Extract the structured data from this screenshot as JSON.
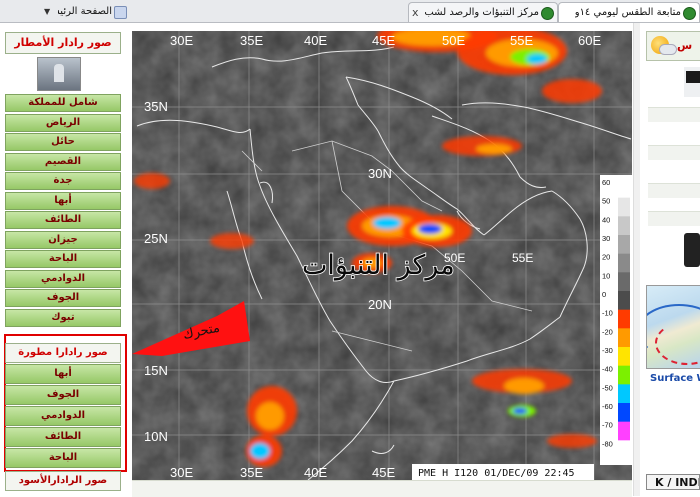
{
  "browser": {
    "tabs": [
      {
        "label": "متابعة الطقس ليومي ١٤و١٥ ١٢/...",
        "active": true
      },
      {
        "label": "مركز التنبؤات والرصد لشب...",
        "active": false
      },
      {
        "label": "الصفحة الرئيسية",
        "active": false
      }
    ],
    "close_glyph": "x",
    "dropdown_glyph": "▼"
  },
  "left_panel": {
    "radar_title": "صور رادار الأمطار",
    "kingdom_items": [
      "شامل للمملكة",
      "الرياض",
      "حائل",
      "القصيم",
      "جدة",
      "أبها",
      "الطائف",
      "جيزان",
      "الباحة",
      "الدوادمي",
      "الجوف",
      "تبوك"
    ],
    "mobile_title": "صور رادارا مطورة",
    "mobile_items": [
      "أبها",
      "الجوف",
      "الدوادمي",
      "الطائف",
      "الباحة"
    ],
    "black_radar_title": "صور الرادارالأسود"
  },
  "satellite": {
    "lon_labels_top": [
      "30E",
      "35E",
      "40E",
      "45E",
      "50E",
      "55E",
      "60E"
    ],
    "lon_labels_mid": [
      "50E",
      "55E"
    ],
    "lon_labels_bottom": [
      "30E",
      "35E",
      "40E",
      "45E"
    ],
    "lat_labels": [
      "35N",
      "30N",
      "25N",
      "20N",
      "15N",
      "10N"
    ],
    "scale_values": [
      "60",
      "50",
      "40",
      "30",
      "20",
      "10",
      "0",
      "-10",
      "-20",
      "-30",
      "-40",
      "-50",
      "-60",
      "-70",
      "-80"
    ],
    "scale_colors": [
      "#ffffff",
      "#e6e6e6",
      "#c8c8c8",
      "#a8a8a8",
      "#8a8a8a",
      "#6a6a6a",
      "#4c4c4c",
      "#ff3b00",
      "#ff9a00",
      "#ffe400",
      "#7cf000",
      "#00c8ff",
      "#0048ff",
      "#ff40ff",
      "#ffffff"
    ],
    "caption": "PME  H  I120  01/DEC/09  22:45",
    "watermark": "مركز التنبؤات",
    "arrow_label": "متحرك"
  },
  "right_panel": {
    "weather_label": "س",
    "surface_label": "Surface W",
    "k_index_label": "K / INDE"
  }
}
